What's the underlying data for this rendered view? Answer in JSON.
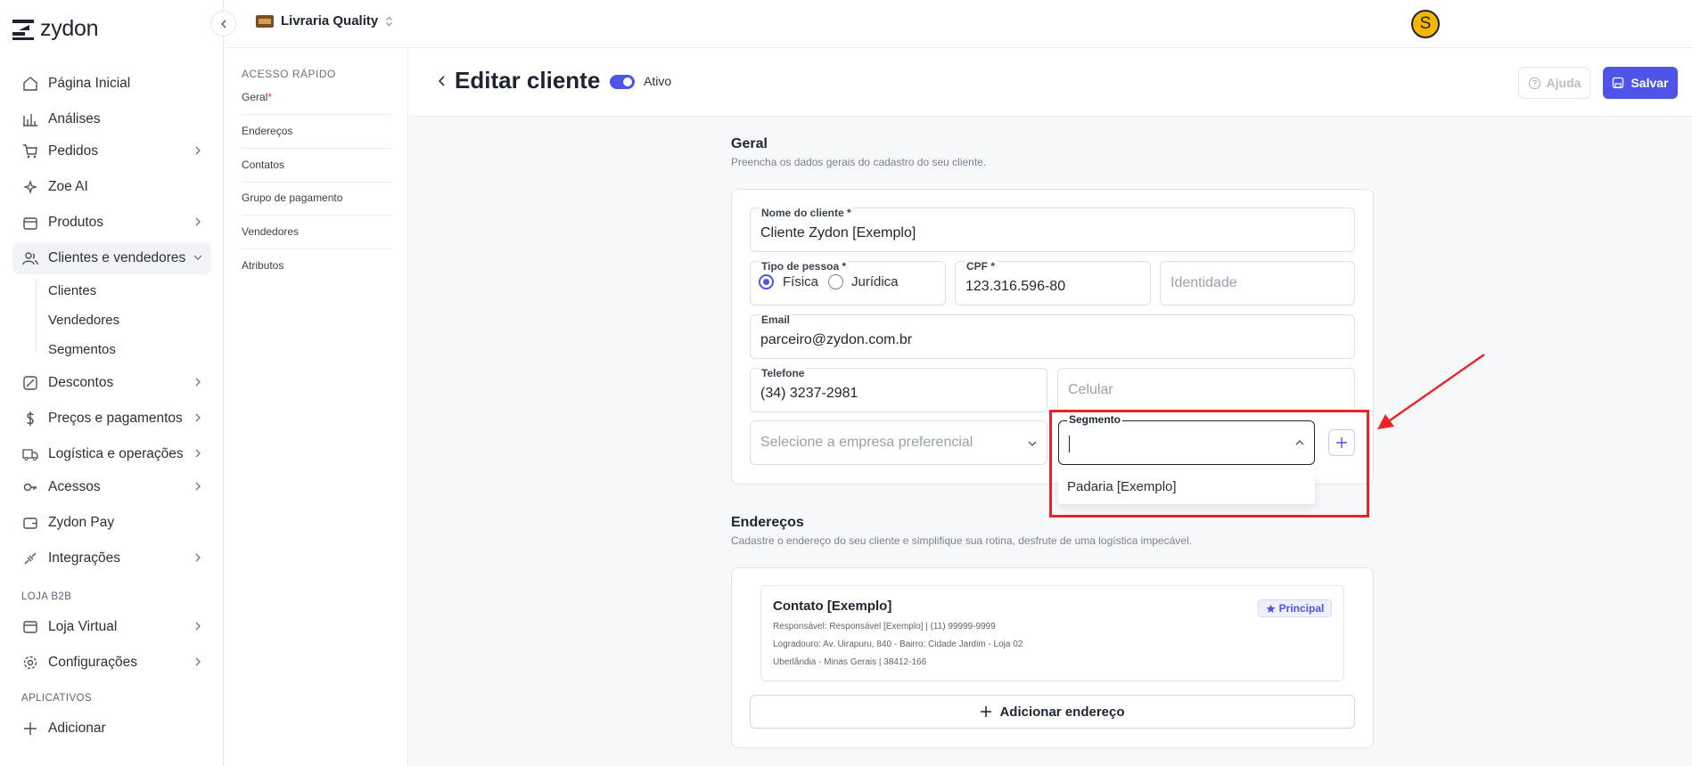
{
  "brand": {
    "name": "zydon"
  },
  "store": {
    "name": "Livraria Quality"
  },
  "user": {
    "initial": "S"
  },
  "sidebar": {
    "items": [
      {
        "label": "Página Inicial"
      },
      {
        "label": "Análises"
      },
      {
        "label": "Pedidos"
      },
      {
        "label": "Zoe AI"
      },
      {
        "label": "Produtos"
      },
      {
        "label": "Clientes e vendedores"
      },
      {
        "label": "Descontos"
      },
      {
        "label": "Preços e pagamentos"
      },
      {
        "label": "Logística e operações"
      },
      {
        "label": "Acessos"
      },
      {
        "label": "Zydon Pay"
      },
      {
        "label": "Integrações"
      },
      {
        "label": "Loja Virtual"
      },
      {
        "label": "Configurações"
      },
      {
        "label": "Adicionar"
      }
    ],
    "subitems": [
      {
        "label": "Clientes"
      },
      {
        "label": "Vendedores"
      },
      {
        "label": "Segmentos"
      }
    ],
    "section_b2b": "LOJA B2B",
    "section_apps": "APLICATIVOS"
  },
  "quick_access": {
    "title": "ACESSO RÁPIDO",
    "items": [
      {
        "label": "Geral",
        "required": "*"
      },
      {
        "label": "Endereços"
      },
      {
        "label": "Contatos"
      },
      {
        "label": "Grupo de pagamento"
      },
      {
        "label": "Vendedores"
      },
      {
        "label": "Atributos"
      }
    ]
  },
  "header": {
    "title": "Editar cliente",
    "status": "Ativo",
    "help": "Ajuda",
    "save": "Salvar"
  },
  "general": {
    "title": "Geral",
    "description": "Preencha os dados gerais do cadastro do seu cliente.",
    "name_label": "Nome do cliente *",
    "name_value": "Cliente Zydon [Exemplo]",
    "person_type_label": "Tipo de pessoa *",
    "person_fisica": "Física",
    "person_juridica": "Jurídica",
    "cpf_label": "CPF *",
    "cpf_value": "123.316.596-80",
    "identity_placeholder": "Identidade",
    "email_label": "Email",
    "email_value": "parceiro@zydon.com.br",
    "phone_label": "Telefone",
    "phone_value": "(34) 3237-2981",
    "mobile_placeholder": "Celular",
    "company_placeholder": "Selecione a empresa preferencial",
    "segment_label": "Segmento",
    "segment_option": "Padaria [Exemplo]"
  },
  "addresses": {
    "title": "Endereços",
    "description": "Cadastre o endereço do seu cliente e simplifique sua rotina, desfrute de uma logística impecável.",
    "card_title": "Contato [Exemplo]",
    "badge": "Principal",
    "line1": "Responsável: Responsável [Exemplo] | (11) 99999-9999",
    "line2": "Logradouro: Av. Uirapuru, 840 - Bairro: Cidade Jardim - Loja 02",
    "line3": "Uberlândia - Minas Gerais | 38412-166",
    "add_button": "Adicionar endereço"
  },
  "colors": {
    "accent": "#4f54e8",
    "annotation": "#e8232a"
  }
}
